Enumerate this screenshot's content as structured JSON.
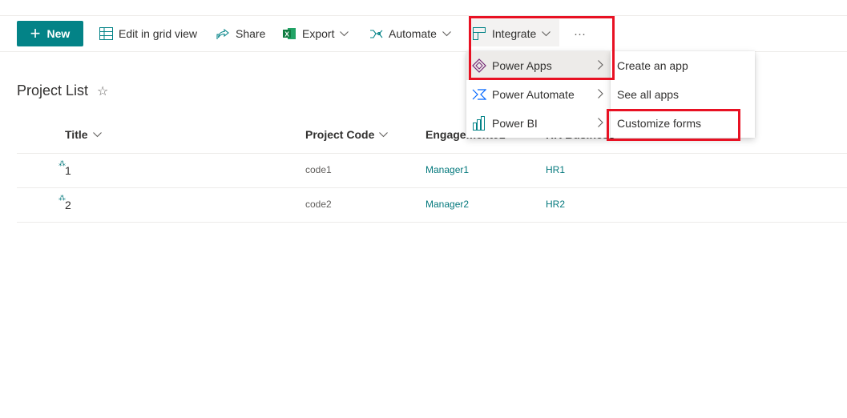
{
  "toolbar": {
    "new_label": "New",
    "edit_grid_label": "Edit in grid view",
    "share_label": "Share",
    "export_label": "Export",
    "automate_label": "Automate",
    "integrate_label": "Integrate",
    "more_label": "···"
  },
  "list": {
    "title": "Project List",
    "favorite_icon": "star-icon",
    "columns": [
      {
        "label": "Title"
      },
      {
        "label": "Project Code"
      },
      {
        "label": "Engagement01"
      },
      {
        "label": "HR Business"
      }
    ],
    "rows": [
      {
        "title": "1",
        "code": "code1",
        "engagement": "Manager1",
        "hr": "HR1"
      },
      {
        "title": "2",
        "code": "code2",
        "engagement": "Manager2",
        "hr": "HR2"
      }
    ]
  },
  "integrate_menu": {
    "items": [
      {
        "label": "Power Apps",
        "icon": "power-apps-icon"
      },
      {
        "label": "Power Automate",
        "icon": "power-automate-icon"
      },
      {
        "label": "Power BI",
        "icon": "power-bi-icon"
      }
    ]
  },
  "power_apps_submenu": {
    "items": [
      {
        "label": "Create an app"
      },
      {
        "label": "See all apps"
      },
      {
        "label": "Customize forms"
      }
    ]
  },
  "colors": {
    "accent": "#038387",
    "link": "#03787c",
    "highlight_box": "#e81123"
  }
}
